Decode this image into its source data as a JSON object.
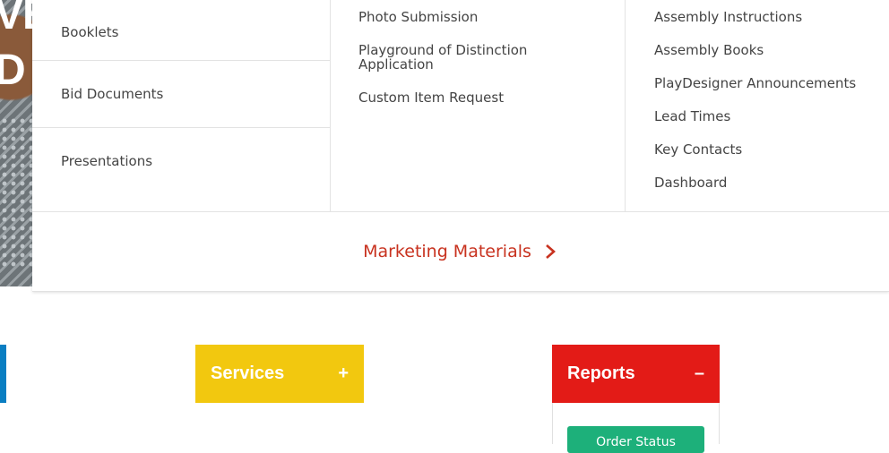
{
  "hero": {
    "partial_text": "VE\nD"
  },
  "mega_menu": {
    "column1": [
      "Booklets",
      "Bid Documents",
      "Presentations"
    ],
    "column2": [
      "Photo Submission",
      "Playground of Distinction Application",
      "Custom Item Request"
    ],
    "column3": [
      "Assembly Instructions",
      "Assembly Books",
      "PlayDesigner Announcements",
      "Lead Times",
      "Key Contacts",
      "Dashboard"
    ],
    "footer_link": "Marketing Materials"
  },
  "tiles": {
    "services": {
      "label": "Services",
      "toggle": "+"
    },
    "reports": {
      "label": "Reports",
      "toggle": "–"
    }
  },
  "reports_panel": {
    "button_label": "Order Status"
  },
  "colors": {
    "marketing_link": "#c8321f",
    "services_tile": "#f2c80f",
    "reports_tile": "#e31b17",
    "green_button": "#1db07a",
    "blue_tab": "#0a7ec2"
  }
}
